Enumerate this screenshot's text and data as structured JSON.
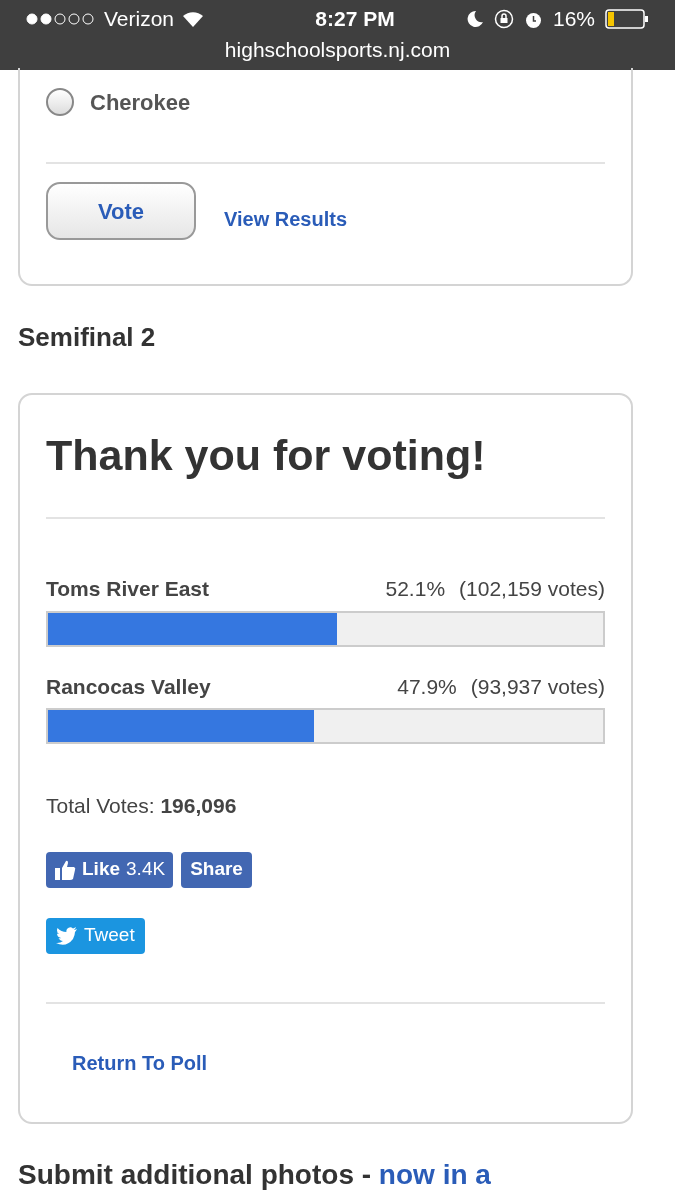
{
  "status_bar": {
    "carrier": "Verizon",
    "time": "8:27 PM",
    "battery": "16%"
  },
  "address_bar": {
    "url": "highschoolsports.nj.com"
  },
  "poll_1": {
    "options": [
      {
        "label": "Cherokee",
        "selected": false
      }
    ],
    "vote_button": "Vote",
    "results_link": "View Results"
  },
  "poll_2": {
    "heading": "Semifinal 2",
    "title": "Thank you for voting!",
    "results": [
      {
        "name": "Toms River East",
        "percent": "52.1%",
        "votes": "(102,159 votes)",
        "level": 0.521
      },
      {
        "name": "Rancocas Valley",
        "percent": "47.9%",
        "votes": "(93,937 votes)",
        "level": 0.479
      }
    ],
    "total_label": "Total Votes:",
    "total": "196,096",
    "like_button": "Like",
    "like_count": "3.4K",
    "share_button": "Share",
    "tweet_button": "Tweet",
    "return_link": "Return To Poll"
  },
  "next_heading": {
    "text": "Submit additional photos - ",
    "link": "now in a"
  }
}
